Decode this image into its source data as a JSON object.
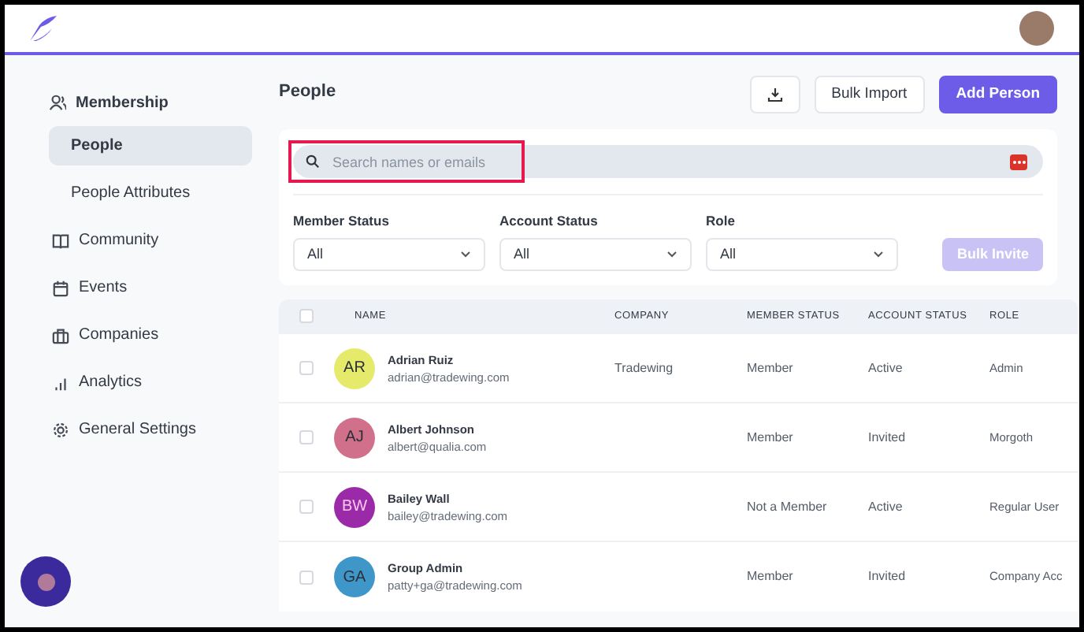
{
  "sidebar": {
    "section": "Membership",
    "items": [
      {
        "label": "People",
        "kind": "sub",
        "selected": true
      },
      {
        "label": "People Attributes",
        "kind": "sub",
        "selected": false
      },
      {
        "label": "Community",
        "kind": "top",
        "selected": false
      },
      {
        "label": "Events",
        "kind": "top",
        "selected": false
      },
      {
        "label": "Companies",
        "kind": "top",
        "selected": false
      },
      {
        "label": "Analytics",
        "kind": "top",
        "selected": false
      },
      {
        "label": "General Settings",
        "kind": "top",
        "selected": false
      }
    ]
  },
  "page": {
    "title": "People",
    "buttons": [
      "Bulk Import",
      "Add Person"
    ]
  },
  "search": {
    "placeholder": "Search names or emails",
    "highlighted": true
  },
  "filters": [
    {
      "label": "Member Status",
      "value": "All"
    },
    {
      "label": "Account Status",
      "value": "All"
    },
    {
      "label": "Role",
      "value": "All"
    }
  ],
  "bulk_invite": {
    "label": "Bulk Invite",
    "disabled": true
  },
  "table": {
    "columns": [
      "NAME",
      "COMPANY",
      "MEMBER STATUS",
      "ACCOUNT STATUS",
      "ROLE"
    ],
    "all_selected": false,
    "rows": [
      {
        "initials": "AR",
        "color": "#e5ea6a",
        "name": "Adrian Ruiz",
        "email": "adrian@tradewing.com",
        "company": "Tradewing",
        "member_status": "Member",
        "account_status": "Active",
        "role": "Admin",
        "selected": false
      },
      {
        "initials": "AJ",
        "color": "#d0708a",
        "name": "Albert Johnson",
        "email": "albert@qualia.com",
        "member_status": "Member",
        "account_status": "Invited",
        "role": "Morgoth",
        "selected": false
      },
      {
        "initials": "BW",
        "color": "#9a2aa8",
        "name": "Bailey Wall",
        "email": "bailey@tradewing.com",
        "member_status": "Not a Member",
        "account_status": "Active",
        "role": "Regular User",
        "selected": false
      },
      {
        "initials": "GA",
        "color": "#3f97c9",
        "name": "Group Admin",
        "email": "patty+ga@tradewing.com",
        "member_status": "Member",
        "account_status": "Invited",
        "role": "Company Acc",
        "selected": false
      }
    ]
  }
}
